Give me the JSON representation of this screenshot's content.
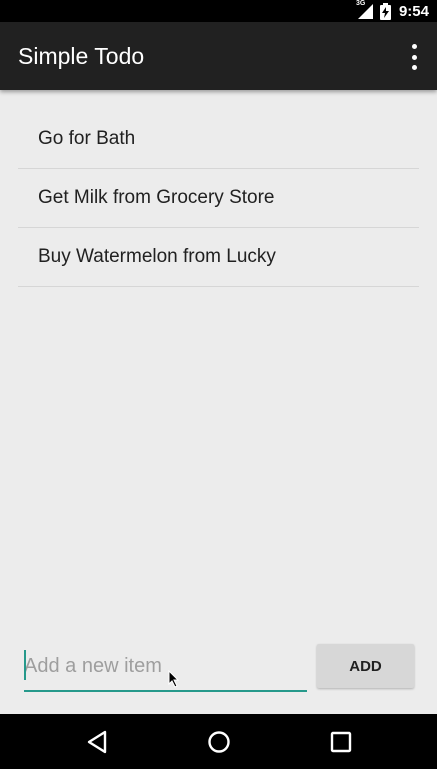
{
  "status_bar": {
    "time": "9:54",
    "network_label": "3G",
    "icons": [
      "signal-icon",
      "battery-charging-icon"
    ]
  },
  "app_bar": {
    "title": "Simple Todo",
    "overflow_icon": "more-vert-icon"
  },
  "todo_items": [
    {
      "label": "Go for Bath"
    },
    {
      "label": "Get Milk from Grocery Store"
    },
    {
      "label": "Buy Watermelon from Lucky"
    }
  ],
  "new_item": {
    "value": "",
    "placeholder": "Add a new item"
  },
  "add_button": {
    "label": "ADD"
  },
  "nav_bar": {
    "buttons": [
      "back-icon",
      "home-icon",
      "recents-icon"
    ]
  },
  "colors": {
    "accent": "#26998b",
    "app_bar": "#212121",
    "background": "#ececec"
  }
}
